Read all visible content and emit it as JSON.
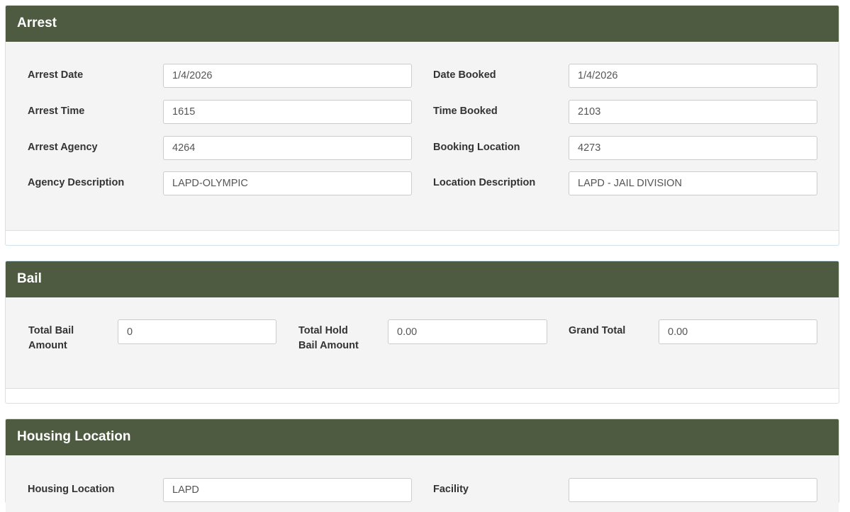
{
  "arrest": {
    "title": "Arrest",
    "arrest_date_label": "Arrest Date",
    "arrest_date": "1/4/2026",
    "arrest_time_label": "Arrest Time",
    "arrest_time": "1615",
    "arrest_agency_label": "Arrest Agency",
    "arrest_agency": "4264",
    "agency_description_label": "Agency Description",
    "agency_description": "LAPD-OLYMPIC",
    "date_booked_label": "Date Booked",
    "date_booked": "1/4/2026",
    "time_booked_label": "Time Booked",
    "time_booked": "2103",
    "booking_location_label": "Booking Location",
    "booking_location": "4273",
    "location_description_label": "Location Description",
    "location_description": "LAPD - JAIL DIVISION"
  },
  "bail": {
    "title": "Bail",
    "total_bail_label_1": "Total Bail",
    "total_bail_label_2": "Amount",
    "total_bail": "0",
    "total_hold_label_1": "Total Hold",
    "total_hold_label_2": "Bail Amount",
    "total_hold": "0.00",
    "grand_total_label": "Grand Total",
    "grand_total": "0.00"
  },
  "housing": {
    "title": "Housing Location",
    "housing_location_label": "Housing Location",
    "housing_location": "LAPD",
    "facility_label": "Facility",
    "facility": ""
  },
  "colors": {
    "header_bg": "#4e5b41",
    "panel_body_bg": "#f4f4f4"
  }
}
